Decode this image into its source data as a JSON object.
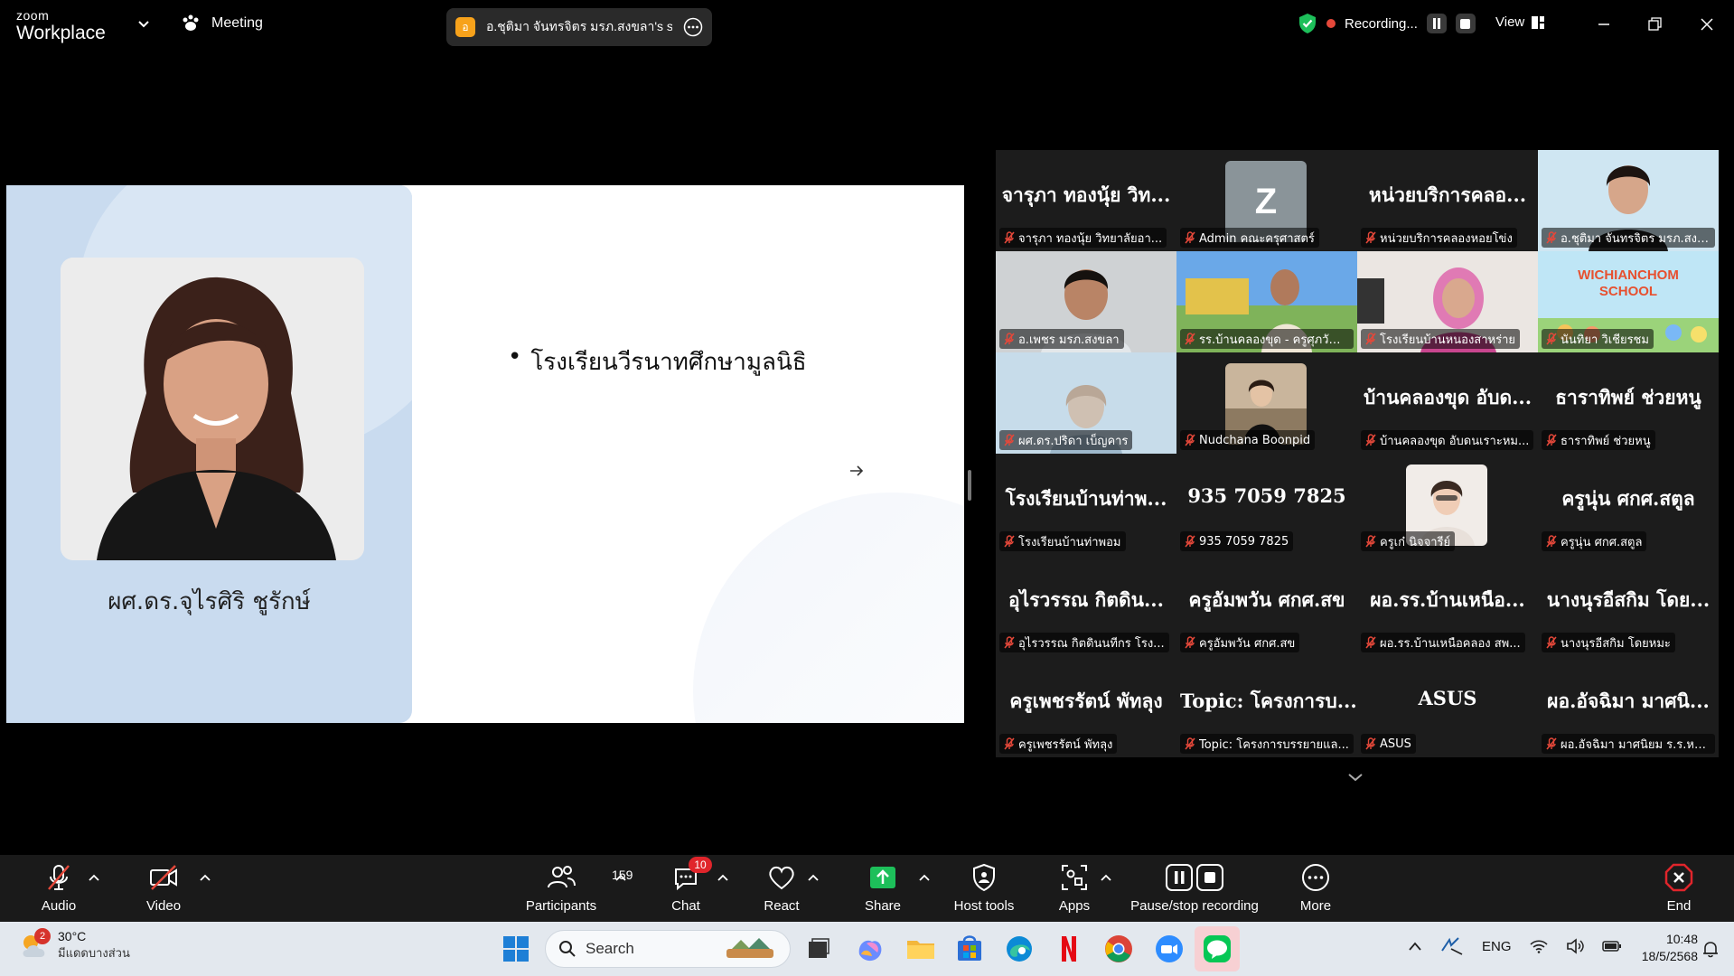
{
  "titlebar": {
    "brand_line1": "zoom",
    "brand_line2": "Workplace",
    "meeting_label": "Meeting",
    "share_initial": "อ",
    "share_title": "อ.ชุติมา จันทรจิตร มรภ.สงขลา's scree",
    "recording_label": "Recording...",
    "view_label": "View"
  },
  "slide": {
    "speaker_name": "ผศ.ดร.จุไรศิริ  ชูรักษ์",
    "bullet_text": "โรงเรียนวีรนาทศึกษามูลนิธิ"
  },
  "gallery": {
    "tiles": [
      {
        "big": "จารุภา ทองนุ้ย วิท...",
        "label": "จารุภา ทองนุ้ย วิทยาลัยอา..."
      },
      {
        "avatar": "Z",
        "label": "Admin คณะครุศาสตร์"
      },
      {
        "big": "หน่วยบริการคลอ...",
        "label": "หน่วยบริการคลองหอยโข่ง"
      },
      {
        "label": "อ.ชุติมา จันทรจิตร มรภ.สงขลา"
      },
      {
        "label": "อ.เพชร มรภ.สงขลา"
      },
      {
        "label": "รร.บ้านคลองขุด - ครูศุภวัฒ..."
      },
      {
        "label": "โรงเรียนบ้านหนองสาหร่าย"
      },
      {
        "label": "นันทิยา วิเชียรชม",
        "banner": "WICHIANCHOM SCHOOL"
      },
      {
        "label": "ผศ.ดร.ปริดา เบ็ญคาร"
      },
      {
        "label": "Nudchana Boonpid"
      },
      {
        "big": "บ้านคลองขุด อับด...",
        "label": "บ้านคลองขุด อับดนเราะหม..."
      },
      {
        "big": "ธาราทิพย์ ช่วยหนู",
        "label": "ธาราทิพย์ ช่วยหนู"
      },
      {
        "big": "โรงเรียนบ้านท่าพ...",
        "label": "โรงเรียนบ้านท่าพอม"
      },
      {
        "big": "935 7059 7825",
        "label": "935 7059 7825"
      },
      {
        "label": "ครูเก๋ นิจจารีย์"
      },
      {
        "big": "ครูนุ่น ศกศ.สตูล",
        "label": "ครูนุ่น ศกศ.สตูล"
      },
      {
        "big": "อุไรวรรณ กิตดิน...",
        "label": "อุไรวรรณ กิตดินนทีกร โรง..."
      },
      {
        "big": "ครูอัมพวัน ศกศ.สข",
        "label": "ครูอัมพวัน ศกศ.สข"
      },
      {
        "big": "ผอ.รร.บ้านเหนือ...",
        "label": "ผอ.รร.บ้านเหนือคลอง สพ..."
      },
      {
        "big": "นางนุรอีสกิม โดย...",
        "label": "นางนุรอีสกิม โดยหมะ"
      },
      {
        "big": "ครูเพชรรัตน์  พัทลุง",
        "label": "ครูเพชรรัตน์  พัทลุง"
      },
      {
        "big": "Topic: โครงการบ...",
        "label": "Topic: โครงการบรรยายแล..."
      },
      {
        "big": "ASUS",
        "label": "ASUS"
      },
      {
        "big": "ผอ.อัจฉิมา มาศนิ...",
        "label": "ผอ.อัจฉิมา มาศนิยม ร.ร.หว..."
      }
    ]
  },
  "toolbar": {
    "audio": "Audio",
    "video": "Video",
    "participants": "Participants",
    "participants_count": "159",
    "chat": "Chat",
    "chat_badge": "10",
    "react": "React",
    "share": "Share",
    "host_tools": "Host tools",
    "apps": "Apps",
    "pause_stop": "Pause/stop recording",
    "more": "More",
    "end": "End"
  },
  "taskbar": {
    "weather_temp": "30°C",
    "weather_desc": "มีแดดบางส่วน",
    "weather_badge": "2",
    "search_placeholder": "Search",
    "lang": "ENG",
    "time": "10:48",
    "date": "18/5/2568"
  },
  "colors": {
    "accent_green": "#23d97a",
    "mute_red": "#e5483a",
    "share_green": "#1dbf5a",
    "toolbar_bg": "#1a1a1a"
  }
}
